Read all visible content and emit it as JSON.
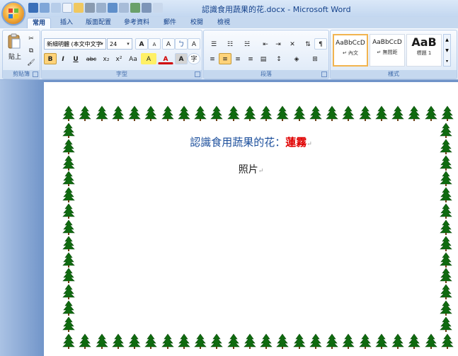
{
  "window": {
    "title": "認識食用蔬果的花.docx - Microsoft Word"
  },
  "tabs": [
    "常用",
    "插入",
    "版面配置",
    "參考資料",
    "郵件",
    "校閱",
    "檢視"
  ],
  "ribbon": {
    "clipboard": {
      "label": "剪貼簿",
      "paste_label": "貼上"
    },
    "font": {
      "label": "字型",
      "font_name": "新細明體 (本文中文字",
      "font_size": "24",
      "bold": "B",
      "italic": "I",
      "underline": "U",
      "strike": "abc",
      "subscript": "x₂",
      "superscript": "x²",
      "change_case": "Aa",
      "grow_font": "A",
      "shrink_font": "A",
      "highlight_char": "A",
      "font_color_char": "A",
      "char_shading": "A",
      "enclose_char": "字",
      "phonetic": "ㄅ",
      "clear_format": "A"
    },
    "paragraph": {
      "label": "段落"
    },
    "styles": {
      "label": "樣式",
      "items": [
        {
          "sample": "AaBbCcD",
          "name": "↵ 內文"
        },
        {
          "sample": "AaBbCcD",
          "name": "↵ 無間距"
        },
        {
          "sample": "AaB",
          "name": "標題 1"
        }
      ]
    }
  },
  "document": {
    "title_prefix": "認識食用蔬果的花：",
    "title_highlight": "蓮霧",
    "paragraph_mark": "↵",
    "photo_text": "照片"
  },
  "colors": {
    "title_blue": "#1c4f9c",
    "title_red": "#e00000",
    "tree_green": "#0f6b0f",
    "ribbon_blue": "#c5d8ef"
  }
}
